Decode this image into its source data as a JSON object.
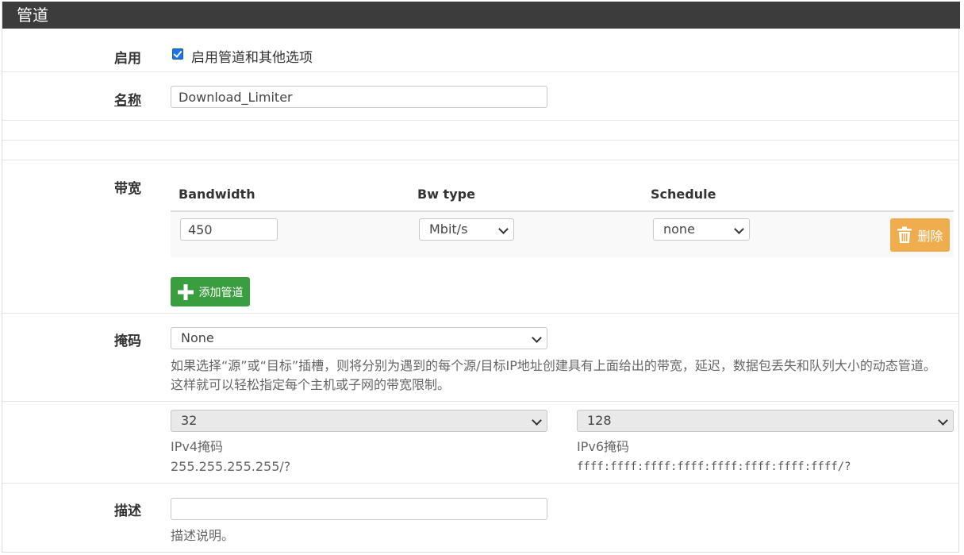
{
  "header": {
    "title": "管道"
  },
  "enable": {
    "label": "启用",
    "checkbox_text": "启用管道和其他选项",
    "checked": true
  },
  "name": {
    "label": "名称",
    "value": "Download_Limiter"
  },
  "bandwidth": {
    "label": "带宽",
    "columns": [
      "Bandwidth",
      "Bw type",
      "Schedule"
    ],
    "rows": [
      {
        "bandwidth": "450",
        "bw_type": "Mbit/s",
        "schedule": "none"
      }
    ],
    "delete_label": "删除",
    "add_label": "添加管道"
  },
  "mask": {
    "label": "掩码",
    "selected": "None",
    "help": "如果选择“源”或“目标”插槽，则将分别为遇到的每个源/目标IP地址创建具有上面给出的带宽，延迟，数据包丢失和队列大小的动态管道。 这样就可以轻松指定每个主机或子网的带宽限制。",
    "ipv4": {
      "value": "32",
      "label": "IPv4掩码",
      "hint": "255.255.255.255/?"
    },
    "ipv6": {
      "value": "128",
      "label": "IPv6掩码",
      "hint": "ffff:ffff:ffff:ffff:ffff:ffff:ffff:ffff/?"
    }
  },
  "description": {
    "label": "描述",
    "value": "",
    "help": "描述说明。"
  },
  "colors": {
    "header_bg": "#3c3c3c",
    "add_button": "#3a9d3f",
    "delete_button": "#f0ad4e",
    "row_bg": "#f9f9f9"
  }
}
